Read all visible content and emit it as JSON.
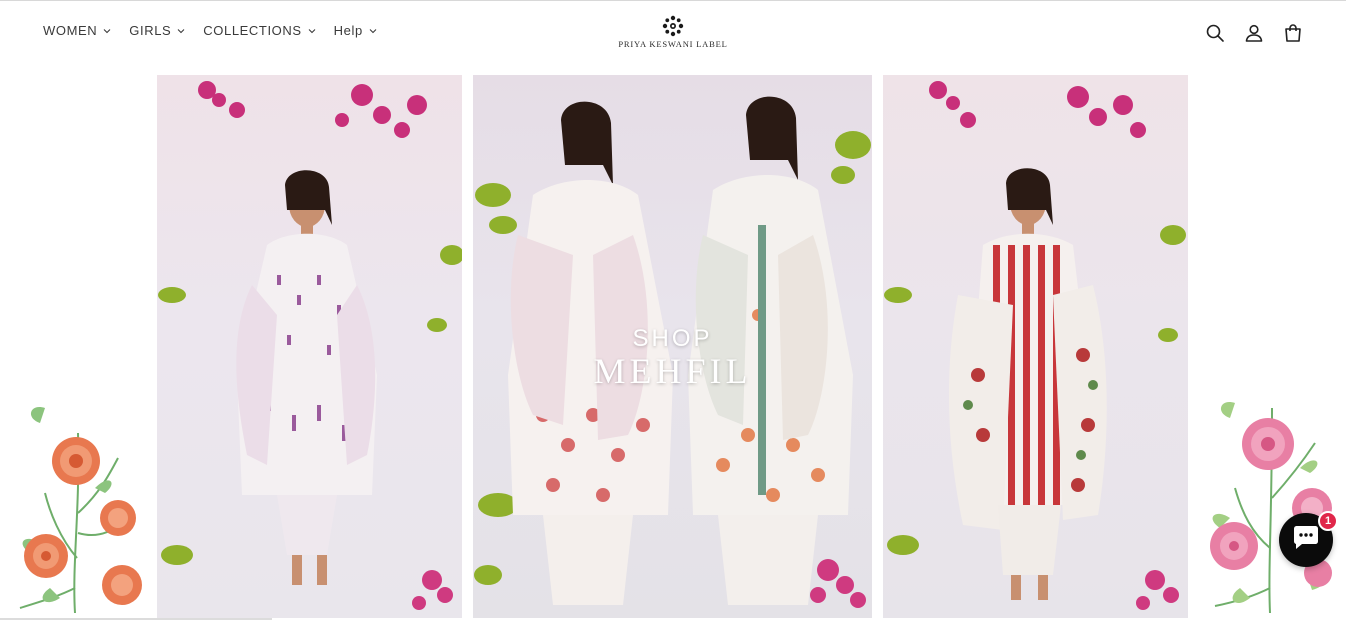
{
  "header": {
    "nav": [
      {
        "label": "WOMEN"
      },
      {
        "label": "GIRLS"
      },
      {
        "label": "COLLECTIONS"
      },
      {
        "label": "Help"
      }
    ],
    "logo_text": "PRIYA KESWANI LABEL",
    "icons": [
      "search-icon",
      "account-icon",
      "cart-icon"
    ]
  },
  "hero": {
    "line1": "SHOP",
    "line2": "MEHFIL"
  },
  "chat": {
    "badge_count": "1",
    "icon": "chat-icon"
  },
  "colors": {
    "text": "#3a3a3a",
    "chat_bg": "#0b0b0b",
    "badge": "#e0264a",
    "bougainvillea": "#c8307a",
    "leaf": "#8fb02c",
    "flower_orange": "#e06a45",
    "flower_pink": "#e67aa2"
  }
}
